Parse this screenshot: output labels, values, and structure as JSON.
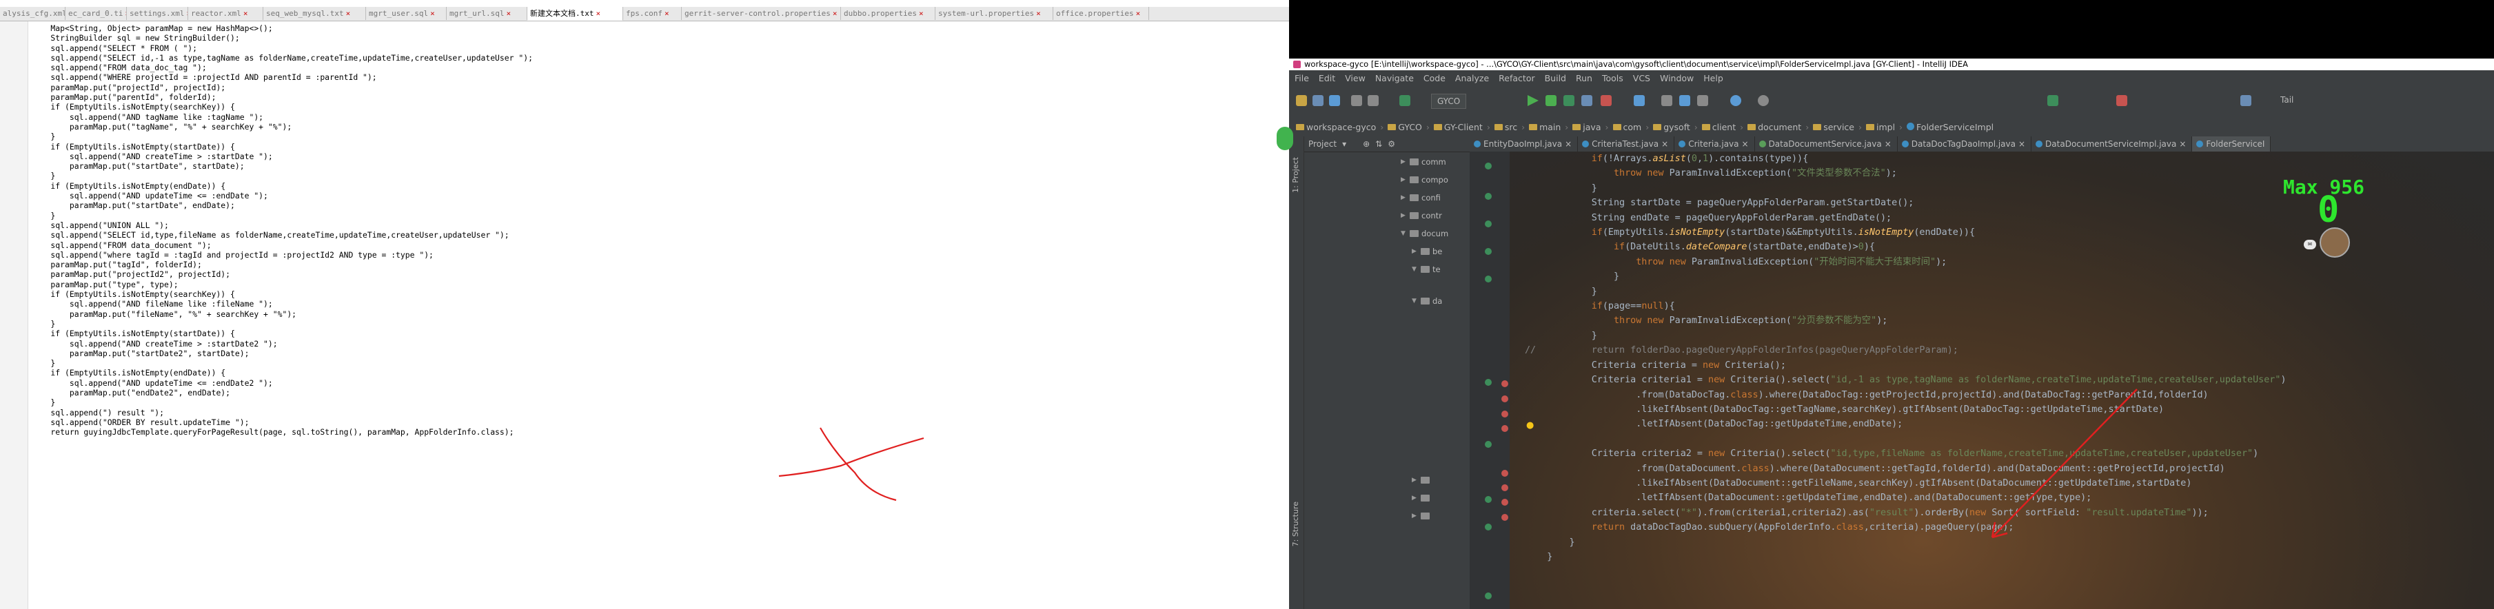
{
  "left_editor": {
    "tabs": [
      {
        "label": "alysis_cfg.xml"
      },
      {
        "label": "ec_card_0.ti"
      },
      {
        "label": "settings.xml"
      },
      {
        "label": "reactor.xml"
      },
      {
        "label": "seq_web_mysql.txt"
      },
      {
        "label": "mgrt_user.sql"
      },
      {
        "label": "mgrt_url.sql"
      },
      {
        "label": "新建文本文档.txt",
        "active": true
      },
      {
        "label": "fps.conf"
      },
      {
        "label": "gerrit-server-control.properties"
      },
      {
        "label": "dubbo.properties"
      },
      {
        "label": "system-url.properties"
      },
      {
        "label": "office.properties"
      }
    ],
    "code": "    Map<String, Object> paramMap = new HashMap<>();\n    StringBuilder sql = new StringBuilder();\n    sql.append(\"SELECT * FROM ( \");\n    sql.append(\"SELECT id,-1 as type,tagName as folderName,createTime,updateTime,createUser,updateUser \");\n    sql.append(\"FROM data_doc_tag \");\n    sql.append(\"WHERE projectId = :projectId AND parentId = :parentId \");\n    paramMap.put(\"projectId\", projectId);\n    paramMap.put(\"parentId\", folderId);\n    if (EmptyUtils.isNotEmpty(searchKey)) {\n        sql.append(\"AND tagName like :tagName \");\n        paramMap.put(\"tagName\", \"%\" + searchKey + \"%\");\n    }\n    if (EmptyUtils.isNotEmpty(startDate)) {\n        sql.append(\"AND createTime > :startDate \");\n        paramMap.put(\"startDate\", startDate);\n    }\n    if (EmptyUtils.isNotEmpty(endDate)) {\n        sql.append(\"AND updateTime <= :endDate \");\n        paramMap.put(\"startDate\", endDate);\n    }\n    sql.append(\"UNION ALL \");\n    sql.append(\"SELECT id,type,fileName as folderName,createTime,updateTime,createUser,updateUser \");\n    sql.append(\"FROM data_document \");\n    sql.append(\"where tagId = :tagId and projectId = :projectId2 AND type = :type \");\n    paramMap.put(\"tagId\", folderId);\n    paramMap.put(\"projectId2\", projectId);\n    paramMap.put(\"type\", type);\n    if (EmptyUtils.isNotEmpty(searchKey)) {\n        sql.append(\"AND fileName like :fileName \");\n        paramMap.put(\"fileName\", \"%\" + searchKey + \"%\");\n    }\n    if (EmptyUtils.isNotEmpty(startDate)) {\n        sql.append(\"AND createTime > :startDate2 \");\n        paramMap.put(\"startDate2\", startDate);\n    }\n    if (EmptyUtils.isNotEmpty(endDate)) {\n        sql.append(\"AND updateTime <= :endDate2 \");\n        paramMap.put(\"endDate2\", endDate);\n    }\n    sql.append(\") result \");\n    sql.append(\"ORDER BY result.updateTime \");\n    return guyingJdbcTemplate.queryForPageResult(page, sql.toString(), paramMap, AppFolderInfo.class);"
  },
  "ide": {
    "title": "workspace-gyco [E:\\intellij\\workspace-gyco] - ...\\GYCO\\GY-Client\\src\\main\\java\\com\\gysoft\\client\\document\\service\\impl\\FolderServiceImpl.java [GY-Client] - IntelliJ IDEA",
    "menu": [
      "File",
      "Edit",
      "View",
      "Navigate",
      "Code",
      "Analyze",
      "Refactor",
      "Build",
      "Run",
      "Tools",
      "VCS",
      "Window",
      "Help"
    ],
    "run_config": "GYCO",
    "tail_label": "Tail",
    "breadcrumbs": [
      "workspace-gyco",
      "GYCO",
      "GY-Client",
      "src",
      "main",
      "java",
      "com",
      "gysoft",
      "client",
      "document",
      "service",
      "impl",
      "FolderServiceImpl"
    ],
    "project_panel_title": "Project",
    "side_labels": {
      "project": "1: Project",
      "structure": "7: Structure"
    },
    "tree_items": [
      "comm",
      "compo",
      "confi",
      "contr",
      "docum",
      "be",
      "te",
      "da"
    ],
    "editor_tabs": [
      {
        "label": "EntityDaoImpl.java"
      },
      {
        "label": "CriteriaTest.java"
      },
      {
        "label": "Criteria.java"
      },
      {
        "label": "DataDocumentService.java"
      },
      {
        "label": "DataDocTagDaoImpl.java"
      },
      {
        "label": "DataDocumentServiceImpl.java"
      },
      {
        "label": "FolderServiceI",
        "active": true
      }
    ],
    "overlay": {
      "max_label": "Max 956",
      "value": "0"
    }
  }
}
